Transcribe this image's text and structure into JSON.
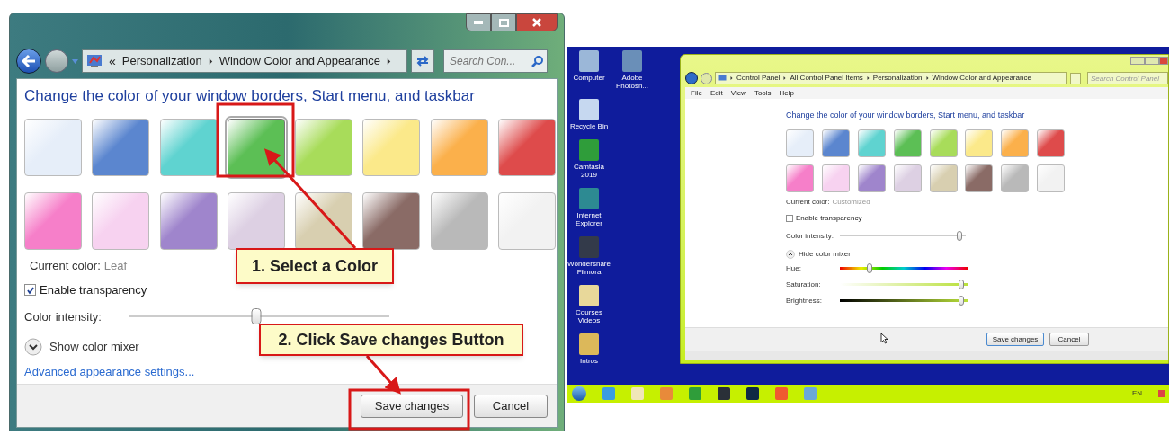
{
  "left_window": {
    "overflow_marker": "«",
    "breadcrumb": [
      "Personalization",
      "Window Color and Appearance"
    ],
    "search": {
      "placeholder": "Search Con..."
    },
    "heading": "Change the color of your window borders, Start menu, and taskbar",
    "swatches": [
      {
        "color": "#e6eef9",
        "selected": false
      },
      {
        "color": "#5b86cf",
        "selected": false
      },
      {
        "color": "#5fd3d0",
        "selected": false
      },
      {
        "color": "#5cbf55",
        "selected": true
      },
      {
        "color": "#a8dc5a",
        "selected": false
      },
      {
        "color": "#fbe98a",
        "selected": false
      },
      {
        "color": "#fbb04b",
        "selected": false
      },
      {
        "color": "#de4b4b",
        "selected": false
      },
      {
        "color": "#f67fc9",
        "selected": false
      },
      {
        "color": "#f7d2f0",
        "selected": false
      },
      {
        "color": "#9f85cc",
        "selected": false
      },
      {
        "color": "#ddd0e3",
        "selected": false
      },
      {
        "color": "#d8cfb0",
        "selected": false
      },
      {
        "color": "#8a6b66",
        "selected": false
      },
      {
        "color": "#b9b9b9",
        "selected": false
      },
      {
        "color": "#f2f2f2",
        "selected": false
      }
    ],
    "current_color": {
      "label": "Current color:",
      "value": "Leaf"
    },
    "transparency": {
      "label": "Enable transparency",
      "checked": true
    },
    "intensity": {
      "label": "Color intensity:",
      "level": 0.49
    },
    "mixer_toggle": {
      "label": "Show color mixer",
      "expanded": false
    },
    "link": "Advanced appearance settings...",
    "buttons": [
      "Save changes",
      "Cancel"
    ]
  },
  "callouts": [
    "1. Select a Color",
    "2. Click Save changes Button"
  ],
  "desktop_icon_rows": [
    [
      "Computer",
      "Adobe Photosh..."
    ],
    [
      "Recycle Bin"
    ],
    [
      "Camtasia 2019"
    ],
    [
      "Internet Explorer"
    ],
    [
      "Wondershare Filmora"
    ],
    [
      "Courses Videos"
    ],
    [
      "Intros"
    ]
  ],
  "right_window": {
    "breadcrumb": [
      "Control Panel",
      "All Control Panel Items",
      "Personalization",
      "Window Color and Appearance"
    ],
    "search": {
      "placeholder": "Search Control Panel"
    },
    "menu": [
      "File",
      "Edit",
      "View",
      "Tools",
      "Help"
    ],
    "heading": "Change the color of your window borders, Start menu, and taskbar",
    "swatches": [
      {
        "color": "#e6eef9"
      },
      {
        "color": "#5b86cf"
      },
      {
        "color": "#5fd3d0"
      },
      {
        "color": "#5cbf55"
      },
      {
        "color": "#a8dc5a"
      },
      {
        "color": "#fbe98a"
      },
      {
        "color": "#fbb04b"
      },
      {
        "color": "#de4b4b"
      },
      {
        "color": "#f67fc9"
      },
      {
        "color": "#f7d2f0"
      },
      {
        "color": "#9f85cc"
      },
      {
        "color": "#ddd0e3"
      },
      {
        "color": "#d8cfb0"
      },
      {
        "color": "#8a6b66"
      },
      {
        "color": "#b9b9b9"
      },
      {
        "color": "#f2f2f2"
      }
    ],
    "current_color": {
      "label": "Current color:",
      "value": "Customized"
    },
    "transparency": {
      "label": "Enable transparency",
      "checked": false
    },
    "intensity": {
      "label": "Color intensity:",
      "level": 0.98
    },
    "mixer_toggle": {
      "label": "Hide color mixer",
      "expanded": true
    },
    "mixer": [
      {
        "kind": "hue",
        "label": "Hue:",
        "level": 0.22
      },
      {
        "kind": "saturation",
        "label": "Saturation:",
        "level": 0.98
      },
      {
        "kind": "brightness",
        "label": "Brightness:",
        "level": 0.98
      }
    ],
    "buttons": [
      "Save changes",
      "Cancel"
    ]
  },
  "tray_language": "EN"
}
